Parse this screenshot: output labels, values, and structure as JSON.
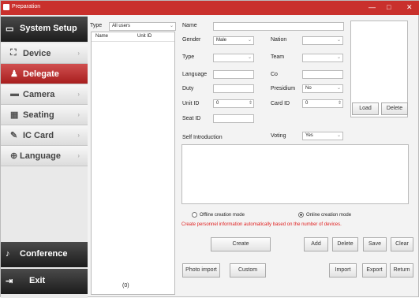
{
  "window": {
    "title": "Preparation"
  },
  "sidebar": {
    "header_label": "System Setup",
    "items": [
      {
        "label": "Device",
        "icon": "network-icon"
      },
      {
        "label": "Delegate",
        "icon": "person-icon",
        "active": true
      },
      {
        "label": "Camera",
        "icon": "camera-icon"
      },
      {
        "label": "Seating",
        "icon": "grid-icon"
      },
      {
        "label": "IC Card",
        "icon": "card-icon"
      },
      {
        "label": "Language",
        "icon": "globe-icon"
      }
    ],
    "conference_label": "Conference",
    "exit_label": "Exit"
  },
  "list_panel": {
    "type_label": "Type",
    "type_value": "All users",
    "columns": [
      "Name",
      "Unit ID"
    ],
    "count_text": "(0)"
  },
  "form": {
    "name_label": "Name",
    "name_value": "",
    "gender_label": "Gender",
    "gender_value": "Male",
    "nation_label": "Nation",
    "nation_value": "",
    "type_label": "Type",
    "type_value": "",
    "team_label": "Team",
    "team_value": "",
    "language_label": "Language",
    "language_value": "",
    "co_label": "Co",
    "co_value": "",
    "duty_label": "Duty",
    "duty_value": "",
    "presidium_label": "Presidium",
    "presidium_value": "No",
    "unit_id_label": "Unit ID",
    "unit_id_value": "0",
    "card_id_label": "Card ID",
    "card_id_value": "0",
    "seat_id_label": "Seat ID",
    "seat_id_value": "",
    "self_intro_label": "Self Introduction",
    "voting_label": "Voting",
    "voting_value": "Yes",
    "self_intro_value": ""
  },
  "photo": {
    "load_label": "Load",
    "delete_label": "Delete"
  },
  "modes": {
    "offline_label": "Offline creation mode",
    "online_label": "Online creation mode",
    "selected": "online",
    "warning_text": "Create personnel information automatically based on the number of devices."
  },
  "buttons": {
    "create": "Create",
    "add": "Add",
    "delete": "Delete",
    "save": "Save",
    "clear": "Clear",
    "photo_import": "Photo import",
    "custom": "Custom",
    "import": "Import",
    "export": "Export",
    "return": "Return"
  },
  "colors": {
    "accent": "#c9302c",
    "warning": "#e02020"
  }
}
